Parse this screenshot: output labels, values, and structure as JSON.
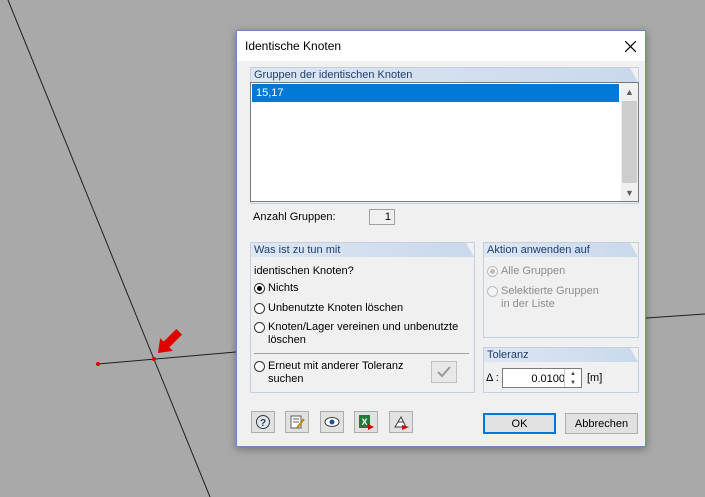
{
  "dialog": {
    "title": "Identische Knoten"
  },
  "groups_section": {
    "header": "Gruppen der identischen Knoten",
    "items": [
      "15,17"
    ],
    "count_label": "Anzahl Gruppen:",
    "count_value": "1"
  },
  "what_to_do": {
    "header": "Was ist zu tun mit",
    "subheading": "identischen Knoten?",
    "options": [
      {
        "label": "Nichts",
        "checked": true
      },
      {
        "label": "Unbenutzte Knoten löschen",
        "checked": false
      },
      {
        "label_line1": "Knoten/Lager vereinen und unbenutzte",
        "label_line2": "löschen",
        "checked": false
      },
      {
        "label_line1": "Erneut mit anderer Toleranz",
        "label_line2": "suchen",
        "checked": false
      }
    ]
  },
  "apply_action": {
    "header": "Aktion anwenden auf",
    "options": [
      {
        "label": "Alle Gruppen",
        "checked": true,
        "disabled": true
      },
      {
        "label_line1": "Selektierte Gruppen",
        "label_line2": "in der Liste",
        "checked": false,
        "disabled": true
      }
    ]
  },
  "tolerance": {
    "header": "Toleranz",
    "symbol": "Δ :",
    "value": "0.0100",
    "unit": "[m]"
  },
  "buttons": {
    "ok": "OK",
    "cancel": "Abbrechen"
  },
  "toolbar_icons": [
    "help-icon",
    "edit-icon",
    "view-icon",
    "excel-export-icon",
    "units-icon"
  ],
  "colors": {
    "selection": "#0078d7",
    "group_header_text": "#1f3d6e",
    "node_marker": "#e00000",
    "arrow": "#e00000",
    "background": "#a9a9a9"
  }
}
